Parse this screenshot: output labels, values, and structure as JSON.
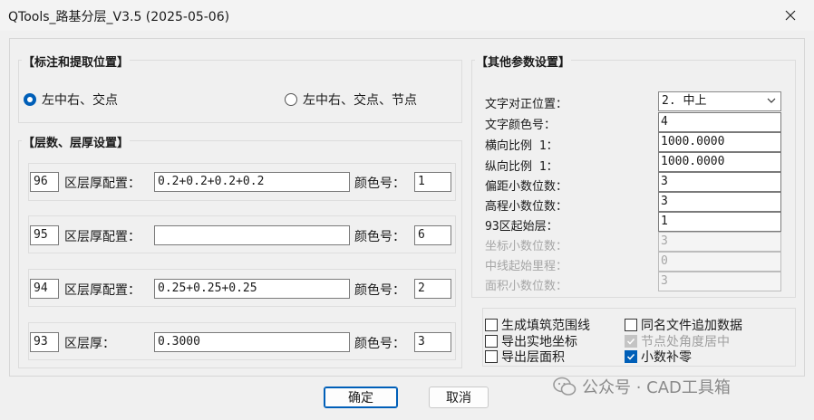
{
  "window": {
    "title": "QTools_路基分层_V3.5  (2025-05-06)"
  },
  "groups": {
    "position_title": "【标注和提取位置】",
    "layer_title": "【层数、层厚设置】",
    "other_title": "【其他参数设置】"
  },
  "radios": [
    {
      "label": "左中右、交点",
      "selected": true
    },
    {
      "label": "左中右、交点、节点",
      "selected": false
    }
  ],
  "layers": [
    {
      "zone": "96",
      "config_label": "区层厚配置：",
      "config_value": "0.2+0.2+0.2+0.2",
      "color_label": "颜色号：",
      "color": "1"
    },
    {
      "zone": "95",
      "config_label": "区层厚配置：",
      "config_value": "",
      "color_label": "颜色号：",
      "color": "6"
    },
    {
      "zone": "94",
      "config_label": "区层厚配置：",
      "config_value": "0.25+0.25+0.25",
      "color_label": "颜色号：",
      "color": "2"
    },
    {
      "zone": "93",
      "config_label": "区层厚：",
      "config_value": "0.3000",
      "color_label": "颜色号：",
      "color": "3"
    }
  ],
  "params": {
    "align_label": "文字对正位置：",
    "align_value": "2. 中上",
    "fields": [
      {
        "label": "文字颜色号：",
        "value": "4",
        "enabled": true
      },
      {
        "label": "横向比例 1：",
        "value": "1000.0000",
        "enabled": true
      },
      {
        "label": "纵向比例 1：",
        "value": "1000.0000",
        "enabled": true
      },
      {
        "label": "偏距小数位数：",
        "value": "3",
        "enabled": true
      },
      {
        "label": "高程小数位数：",
        "value": "3",
        "enabled": true
      },
      {
        "label": "93区起始层：",
        "value": "1",
        "enabled": true
      },
      {
        "label": "坐标小数位数：",
        "value": "3",
        "enabled": false
      },
      {
        "label": "中线起始里程：",
        "value": "0",
        "enabled": false
      },
      {
        "label": "面积小数位数：",
        "value": "3",
        "enabled": false
      }
    ]
  },
  "checkboxes": [
    {
      "label": "生成填筑范围线",
      "checked": false,
      "enabled": true
    },
    {
      "label": "导出实地坐标",
      "checked": false,
      "enabled": true
    },
    {
      "label": "导出层面积",
      "checked": false,
      "enabled": true
    },
    {
      "label": "同名文件追加数据",
      "checked": false,
      "enabled": true
    },
    {
      "label": "节点处角度居中",
      "checked": true,
      "enabled": false
    },
    {
      "label": "小数补零",
      "checked": true,
      "enabled": true
    }
  ],
  "buttons": {
    "ok": "确定",
    "cancel": "取消"
  },
  "watermark": "公众号 · CAD工具箱",
  "colors": {
    "accent": "#005fb8",
    "window_bg": "#f0f0f0"
  }
}
